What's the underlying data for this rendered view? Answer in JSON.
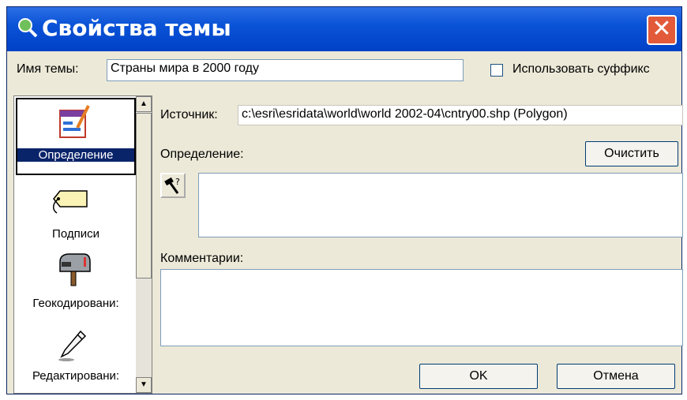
{
  "window": {
    "title": "Свойства темы",
    "close_icon": "close-icon"
  },
  "theme_name": {
    "label": "Имя темы:",
    "value": "Страны мира в 2000 году"
  },
  "suffix": {
    "label": "Использовать суффикс",
    "checked": false
  },
  "sidebar": {
    "items": [
      {
        "label": "Определение",
        "icon": "definition-icon",
        "selected": true
      },
      {
        "label": "Подписи",
        "icon": "tag-label-icon"
      },
      {
        "label": "Геокодировани:",
        "icon": "mailbox-icon"
      },
      {
        "label": "Редактировани:",
        "icon": "pencil-icon"
      }
    ]
  },
  "source": {
    "label": "Источник:",
    "value": "c:\\esri\\esridata\\world\\world 2002-04\\cntry00.shp (Polygon)"
  },
  "definition": {
    "label": "Определение:",
    "clear_label": "Очистить"
  },
  "comments": {
    "label": "Комментарии:"
  },
  "buttons": {
    "ok": "OK",
    "cancel": "Отмена"
  }
}
